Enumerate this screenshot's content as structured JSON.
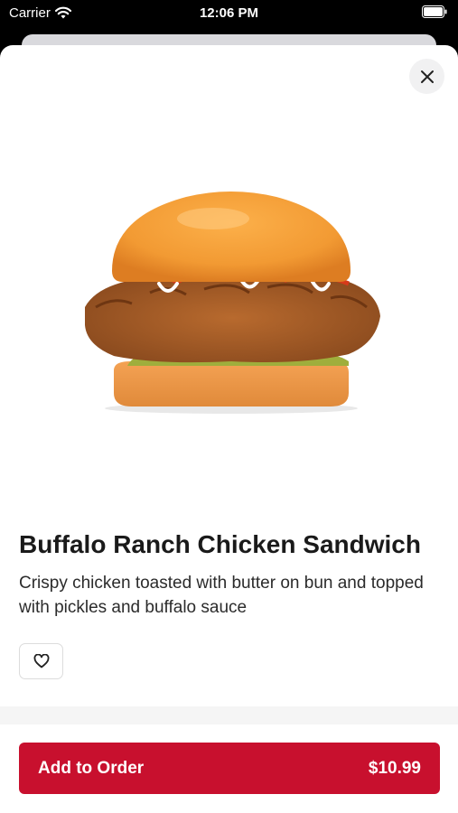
{
  "status_bar": {
    "carrier": "Carrier",
    "time": "12:06 PM"
  },
  "product": {
    "title": "Buffalo Ranch Chicken Sandwich",
    "description": "Crispy chicken toasted with butter on bun and topped with pickles and buffalo sauce"
  },
  "order_button": {
    "label": "Add to Order",
    "price": "$10.99"
  },
  "colors": {
    "accent": "#c8102e"
  },
  "icons": [
    "wifi-icon",
    "battery-icon",
    "close-icon",
    "heart-icon"
  ]
}
